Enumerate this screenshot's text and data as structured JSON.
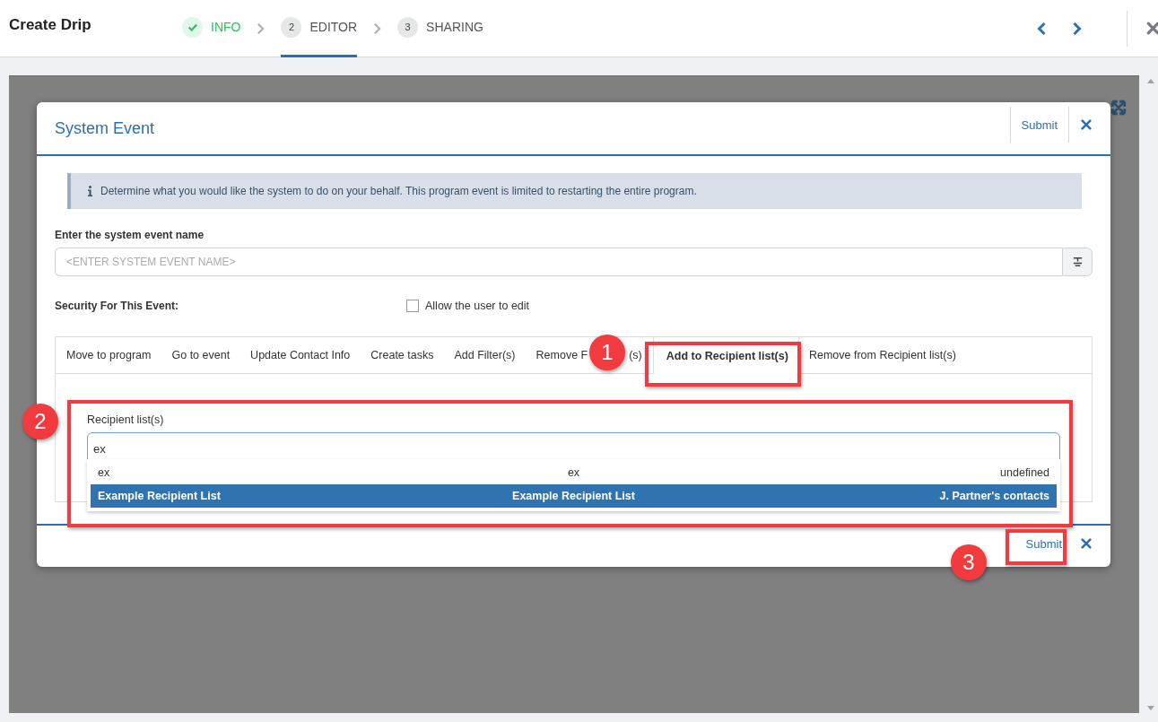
{
  "header": {
    "title": "Create Drip",
    "steps": [
      {
        "label": "INFO",
        "done": true,
        "selected": false
      },
      {
        "number": "2",
        "label": "EDITOR",
        "done": false,
        "selected": true
      },
      {
        "number": "3",
        "label": "SHARING",
        "done": false,
        "selected": false
      }
    ]
  },
  "modal": {
    "title": "System Event",
    "submit": "Submit",
    "info": "Determine what you would like the system to do on your behalf. This program event is limited to restarting the entire program.",
    "name_label": "Enter the system event name",
    "name_placeholder": "<ENTER SYSTEM EVENT NAME>",
    "security_label": "Security For This Event:",
    "allow_edit": {
      "label": "Allow the user to edit",
      "checked": false
    },
    "tabs": [
      {
        "label": "Move to program",
        "selected": false
      },
      {
        "label": "Go to event",
        "selected": false
      },
      {
        "label": "Update Contact Info",
        "selected": false
      },
      {
        "label": "Create tasks",
        "selected": false
      },
      {
        "label": "Add Filter(s)",
        "selected": false
      },
      {
        "label": "Remove F",
        "label_end": "(s)",
        "selected": false
      },
      {
        "label": "Add to Recipient list(s)",
        "selected": true
      },
      {
        "label": "Remove from Recipient list(s)",
        "selected": false
      }
    ],
    "recipient": {
      "label": "Recipient list(s)",
      "value": "ex",
      "options": [
        {
          "columns": [
            "ex",
            "ex",
            "undefined"
          ],
          "selected": false
        },
        {
          "columns": [
            "Example Recipient List",
            "Example Recipient List",
            "J. Partner's contacts"
          ],
          "selected": true
        }
      ]
    },
    "footer_submit": "Submit"
  },
  "annotations": [
    {
      "number": "1"
    },
    {
      "number": "2"
    },
    {
      "number": "3"
    }
  ]
}
